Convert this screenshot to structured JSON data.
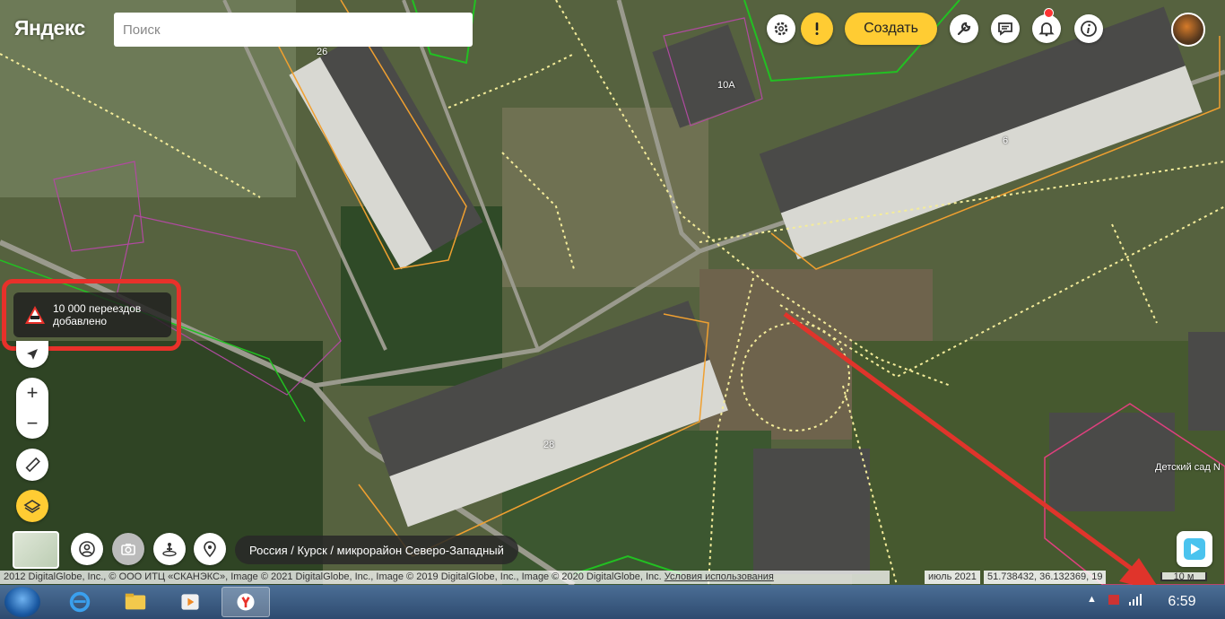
{
  "app": {
    "logo": "Яндекс"
  },
  "search": {
    "placeholder": "Поиск"
  },
  "toolbar": {
    "create_label": "Создать"
  },
  "toast": {
    "line1": "10 000 переездов",
    "line2": "добавлено"
  },
  "zoom": {
    "plus": "+",
    "minus": "−"
  },
  "breadcrumb": "Россия / Курск / микрорайон Северо-Западный",
  "copyright": {
    "text": "2012 DigitalGlobe, Inc., © ООО ИТЦ «СКАНЭКС», Image © 2021 DigitalGlobe, Inc., Image © 2019 DigitalGlobe, Inc., Image © 2020 DigitalGlobe, Inc.",
    "terms_link": "Условия использования"
  },
  "imagery_date": "июль 2021",
  "coordinates": "51.738432, 36.132369, 19",
  "scale": "10 м",
  "map_labels": {
    "building_26": "26",
    "building_10a": "10А",
    "building_6": "6",
    "building_28": "28",
    "poi_kindergarten": "Детский сад N"
  },
  "taskbar": {
    "clock": "6:59"
  },
  "colors": {
    "accent": "#ffcc33",
    "highlight": "#e8312a",
    "parcel_orange": "#f0a030",
    "parcel_pink": "#d04a9a",
    "boundary_green": "#22c022"
  },
  "icons": [
    "gear-icon",
    "alert-icon",
    "wrench-icon",
    "feedback-icon",
    "bell-icon",
    "info-icon",
    "location-arrow-icon",
    "ruler-icon",
    "layers-icon",
    "person-icon",
    "camera-icon",
    "panorama-icon",
    "pin-icon",
    "play-icon"
  ]
}
